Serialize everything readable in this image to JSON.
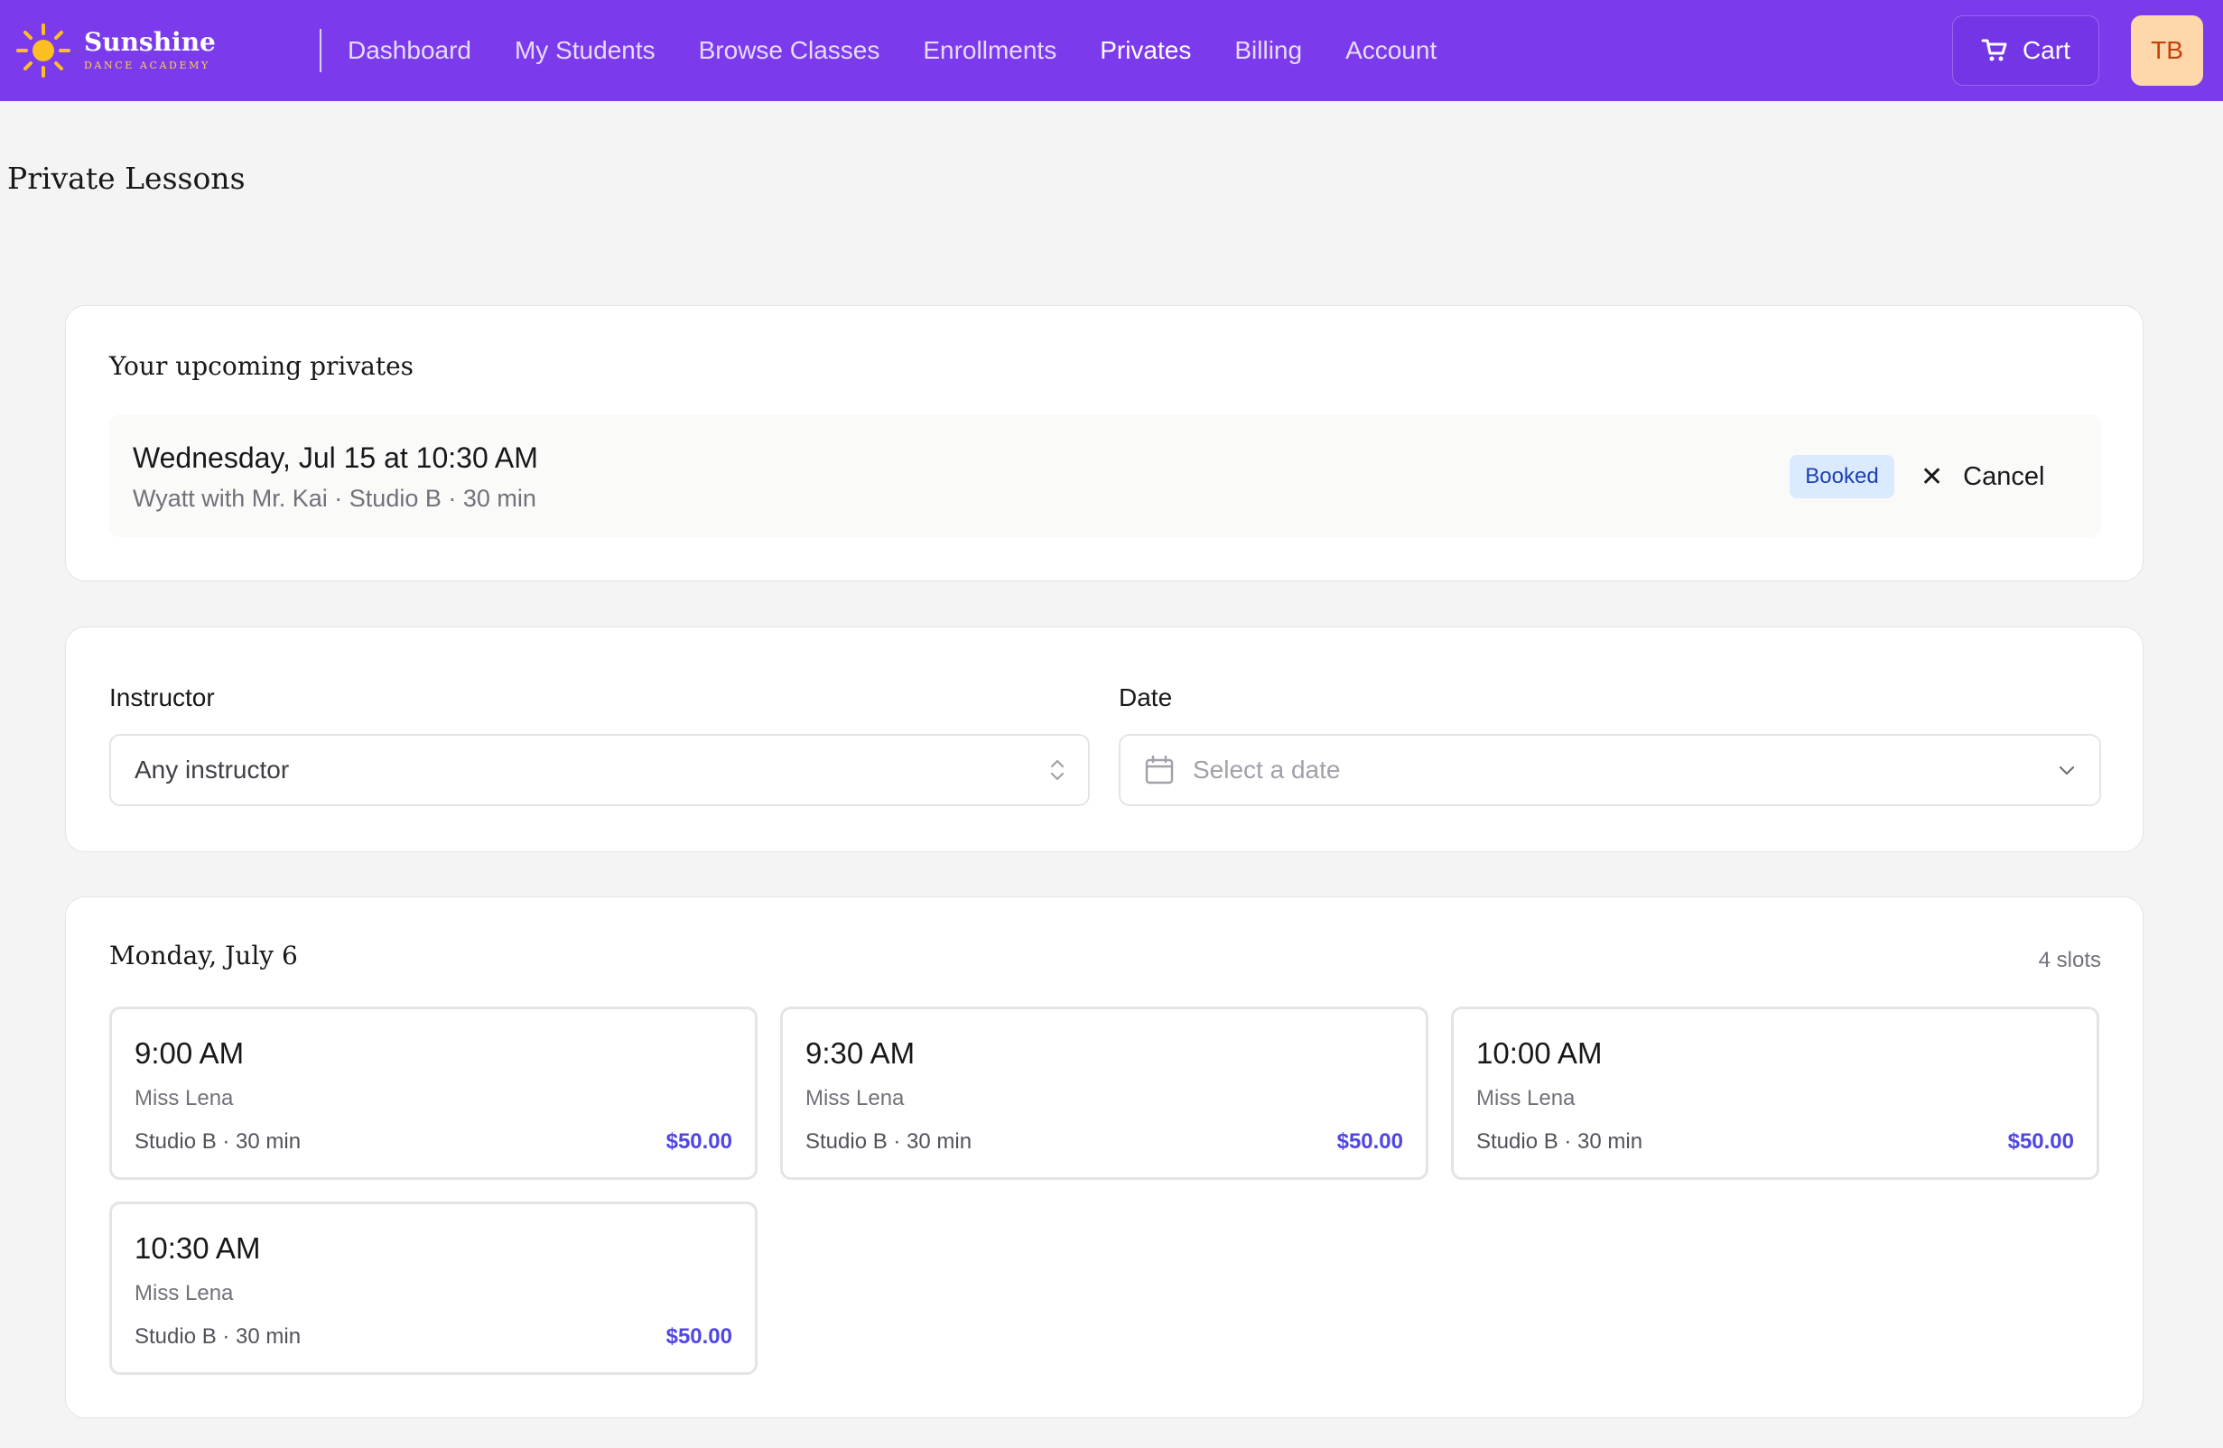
{
  "header": {
    "brand_name": "Sunshine",
    "brand_subtitle": "DANCE ACADEMY",
    "nav": [
      {
        "label": "Dashboard",
        "active": false
      },
      {
        "label": "My Students",
        "active": false
      },
      {
        "label": "Browse Classes",
        "active": false
      },
      {
        "label": "Enrollments",
        "active": false
      },
      {
        "label": "Privates",
        "active": true
      },
      {
        "label": "Billing",
        "active": false
      },
      {
        "label": "Account",
        "active": false
      }
    ],
    "cart_label": "Cart",
    "avatar_initials": "TB",
    "colors": {
      "bar": "#7c3aed",
      "avatar_bg": "#fed7aa",
      "logo": "#fbbf24"
    }
  },
  "page": {
    "title": "Private Lessons"
  },
  "upcoming": {
    "heading": "Your upcoming privates",
    "items": [
      {
        "title": "Wednesday, Jul 15 at 10:30 AM",
        "details": "Wyatt with Mr. Kai · Studio B · 30 min",
        "status": "Booked",
        "cancel_label": "Cancel"
      }
    ]
  },
  "filters": {
    "instructor_label": "Instructor",
    "instructor_value": "Any instructor",
    "date_label": "Date",
    "date_placeholder": "Select a date"
  },
  "schedule": {
    "day_heading": "Monday, July 6",
    "slot_count": "4 slots",
    "slots": [
      {
        "time": "9:00 AM",
        "instructor": "Miss Lena",
        "meta": "Studio B · 30 min",
        "price": "$50.00"
      },
      {
        "time": "9:30 AM",
        "instructor": "Miss Lena",
        "meta": "Studio B · 30 min",
        "price": "$50.00"
      },
      {
        "time": "10:00 AM",
        "instructor": "Miss Lena",
        "meta": "Studio B · 30 min",
        "price": "$50.00"
      },
      {
        "time": "10:30 AM",
        "instructor": "Miss Lena",
        "meta": "Studio B · 30 min",
        "price": "$50.00"
      }
    ]
  }
}
